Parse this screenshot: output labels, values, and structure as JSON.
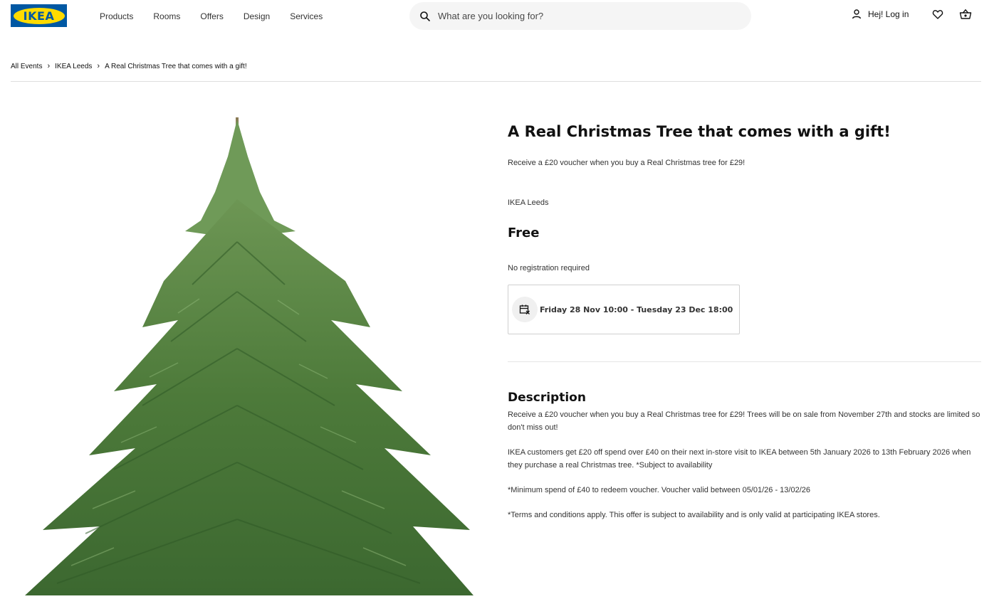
{
  "header": {
    "logo_text": "IKEA",
    "nav": [
      "Products",
      "Rooms",
      "Offers",
      "Design",
      "Services"
    ],
    "search_placeholder": "What are you looking for?",
    "login_label": "Hej! Log in",
    "icons": [
      "search-icon",
      "user-icon",
      "heart-icon",
      "basket-icon"
    ]
  },
  "breadcrumb": [
    "All Events",
    "IKEA Leeds",
    "A Real Christmas Tree that comes with a gift!"
  ],
  "event": {
    "title": "A Real Christmas Tree that comes with a gift!",
    "subtitle": "Receive a £20 voucher when you buy a Real Christmas tree for £29!",
    "location": "IKEA Leeds",
    "price": "Free",
    "registration": "No registration required",
    "date_range": "Friday 28 Nov 10:00 - Tuesday 23 Dec 18:00"
  },
  "description": {
    "heading": "Description",
    "paragraphs": [
      "Receive a £20 voucher when you buy a Real Christmas tree for £29! Trees will be on sale from  November 27th and stocks are limited so don't miss out!",
      "IKEA customers get £20 off spend over £40 on their next in-store visit to IKEA between 5th January 2026 to 13th February 2026 when they purchase a real Christmas tree. *Subject to availability",
      "*Minimum spend of £40 to redeem voucher. Voucher valid between 05/01/26 - 13/02/26",
      "*Terms and conditions apply. This offer is subject to availability and is only valid at participating IKEA stores."
    ]
  },
  "colors": {
    "brand_blue": "#0058a3",
    "brand_yellow": "#ffdb00",
    "tree_green": "#4f7a3a"
  }
}
